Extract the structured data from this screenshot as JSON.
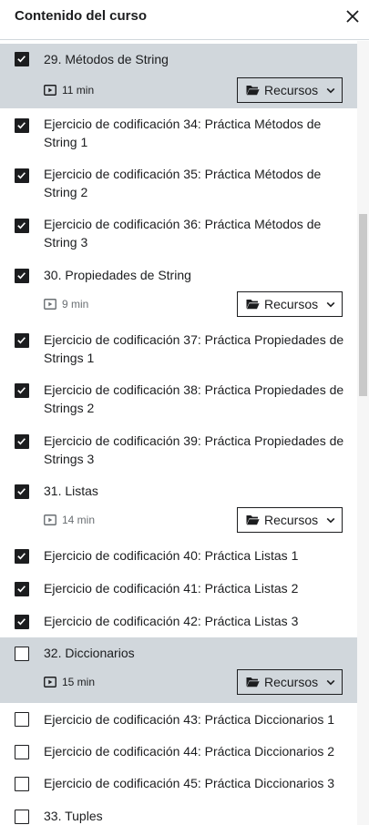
{
  "header": {
    "title": "Contenido del curso"
  },
  "items": [
    {
      "label": "29. Métodos de String",
      "duration": "11 min",
      "resources": "Recursos",
      "checked": true,
      "active": true
    },
    {
      "label": "Ejercicio de codificación 34: Práctica Métodos de String 1",
      "checked": true
    },
    {
      "label": "Ejercicio de codificación 35: Práctica Métodos de String 2",
      "checked": true
    },
    {
      "label": "Ejercicio de codificación 36: Práctica Métodos de String 3",
      "checked": true
    },
    {
      "label": "30. Propiedades de String",
      "duration": "9 min",
      "resources": "Recursos",
      "checked": true
    },
    {
      "label": "Ejercicio de codificación 37: Práctica Propiedades de Strings 1",
      "checked": true
    },
    {
      "label": "Ejercicio de codificación 38: Práctica Propiedades de Strings 2",
      "checked": true
    },
    {
      "label": "Ejercicio de codificación 39: Práctica Propiedades de Strings 3",
      "checked": true
    },
    {
      "label": "31. Listas",
      "duration": "14 min",
      "resources": "Recursos",
      "checked": true
    },
    {
      "label": "Ejercicio de codificación 40: Práctica Listas 1",
      "checked": true
    },
    {
      "label": "Ejercicio de codificación 41: Práctica Listas 2",
      "checked": true
    },
    {
      "label": "Ejercicio de codificación 42: Práctica Listas 3",
      "checked": true
    },
    {
      "label": "32. Diccionarios",
      "duration": "15 min",
      "resources": "Recursos",
      "checked": false,
      "active": true
    },
    {
      "label": "Ejercicio de codificación 43: Práctica Diccionarios 1",
      "checked": false
    },
    {
      "label": "Ejercicio de codificación 44: Práctica Diccionarios 2",
      "checked": false
    },
    {
      "label": "Ejercicio de codificación 45: Práctica Diccionarios 3",
      "checked": false
    },
    {
      "label": "33. Tuples",
      "checked": false
    }
  ]
}
